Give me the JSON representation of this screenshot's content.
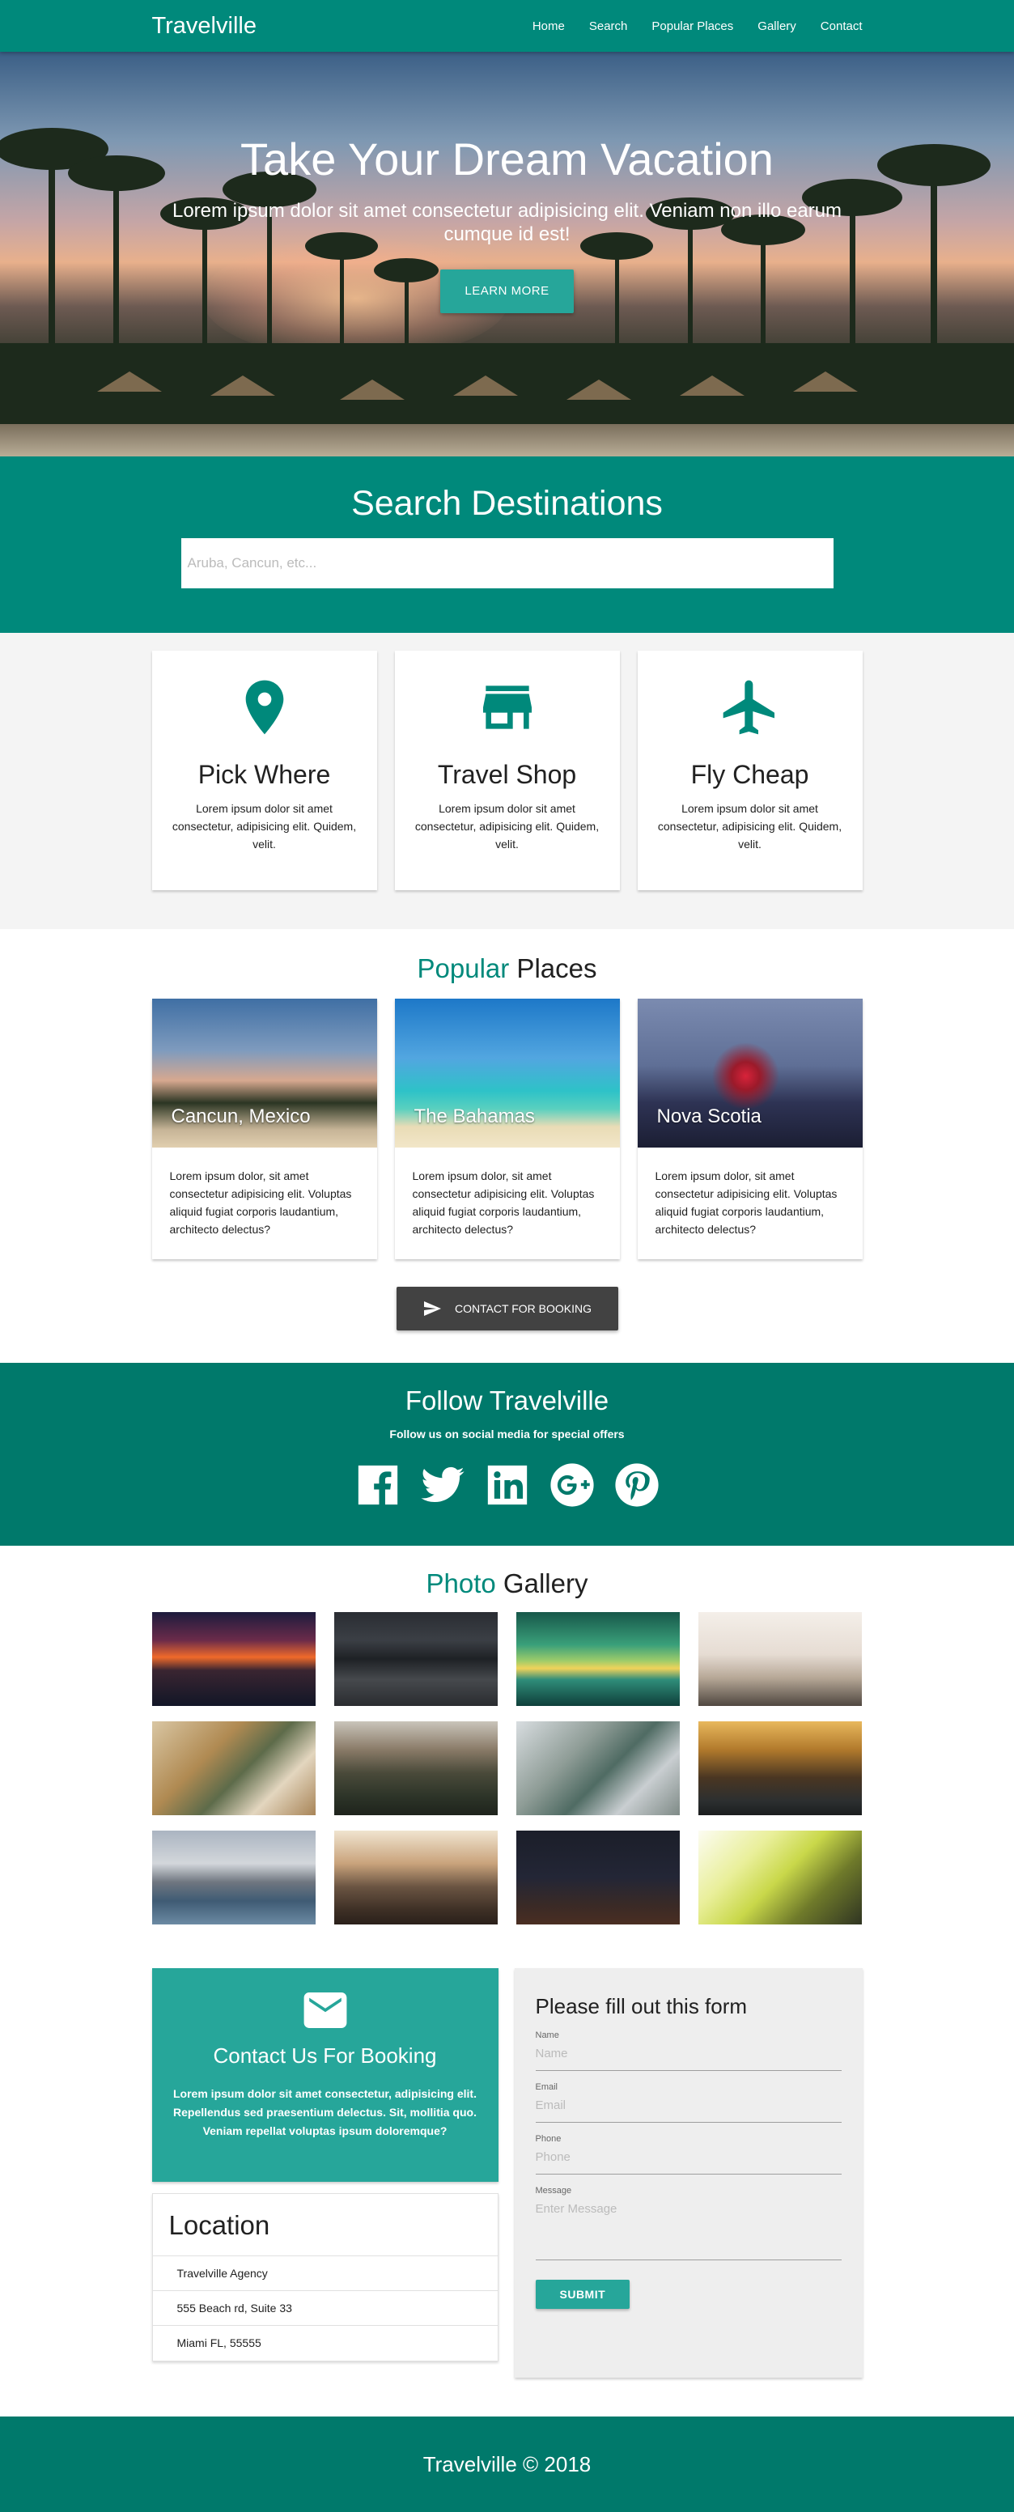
{
  "nav": {
    "brand": "Travelville",
    "links": [
      "Home",
      "Search",
      "Popular Places",
      "Gallery",
      "Contact"
    ]
  },
  "hero": {
    "title": "Take Your Dream Vacation",
    "subtitle": "Lorem ipsum dolor sit amet consectetur adipisicing elit. Veniam non illo earum cumque id est!",
    "button": "LEARN MORE"
  },
  "search": {
    "title": "Search Destinations",
    "placeholder": "Aruba, Cancun, etc..."
  },
  "features": [
    {
      "icon": "map-pin-icon",
      "title": "Pick Where",
      "text": "Lorem ipsum dolor sit amet consectetur, adipisicing elit. Quidem, velit."
    },
    {
      "icon": "store-icon",
      "title": "Travel Shop",
      "text": "Lorem ipsum dolor sit amet consectetur, adipisicing elit. Quidem, velit."
    },
    {
      "icon": "airplane-icon",
      "title": "Fly Cheap",
      "text": "Lorem ipsum dolor sit amet consectetur, adipisicing elit. Quidem, velit."
    }
  ],
  "popular": {
    "title_accent": "Popular",
    "title_rest": " Places",
    "places": [
      {
        "name": "Cancun, Mexico",
        "text": "Lorem ipsum dolor, sit amet consectetur adipisicing elit. Voluptas aliquid fugiat corporis laudantium, architecto delectus?"
      },
      {
        "name": "The Bahamas",
        "text": "Lorem ipsum dolor, sit amet consectetur adipisicing elit. Voluptas aliquid fugiat corporis laudantium, architecto delectus?"
      },
      {
        "name": "Nova Scotia",
        "text": "Lorem ipsum dolor, sit amet consectetur adipisicing elit. Voluptas aliquid fugiat corporis laudantium, architecto delectus?"
      }
    ],
    "button": "CONTACT FOR BOOKING"
  },
  "follow": {
    "title": "Follow Travelville",
    "subtitle": "Follow us on social media for special offers",
    "networks": [
      "facebook-icon",
      "twitter-icon",
      "linkedin-icon",
      "google-plus-icon",
      "pinterest-icon"
    ]
  },
  "gallery": {
    "title_accent": "Photo",
    "title_rest": " Gallery"
  },
  "contact": {
    "box_title": "Contact Us For Booking",
    "box_text": "Lorem ipsum dolor sit amet consectetur, adipisicing elit. Repellendus sed praesentium delectus. Sit, mollitia quo. Veniam repellat voluptas ipsum doloremque?",
    "location_title": "Location",
    "location_lines": [
      "Travelville Agency",
      "555 Beach rd, Suite 33",
      "Miami FL, 55555"
    ],
    "form_title": "Please fill out this form",
    "fields": [
      {
        "label": "Name",
        "placeholder": "Name"
      },
      {
        "label": "Email",
        "placeholder": "Email"
      },
      {
        "label": "Phone",
        "placeholder": "Phone"
      },
      {
        "label": "Message",
        "placeholder": "Enter Message"
      }
    ],
    "submit": "SUBMIT"
  },
  "footer": {
    "text": "Travelville © 2018"
  },
  "colors": {
    "primary": "#00897b",
    "primary_dark": "#00796b",
    "accent": "#26a69a",
    "dark_button": "#424242"
  }
}
